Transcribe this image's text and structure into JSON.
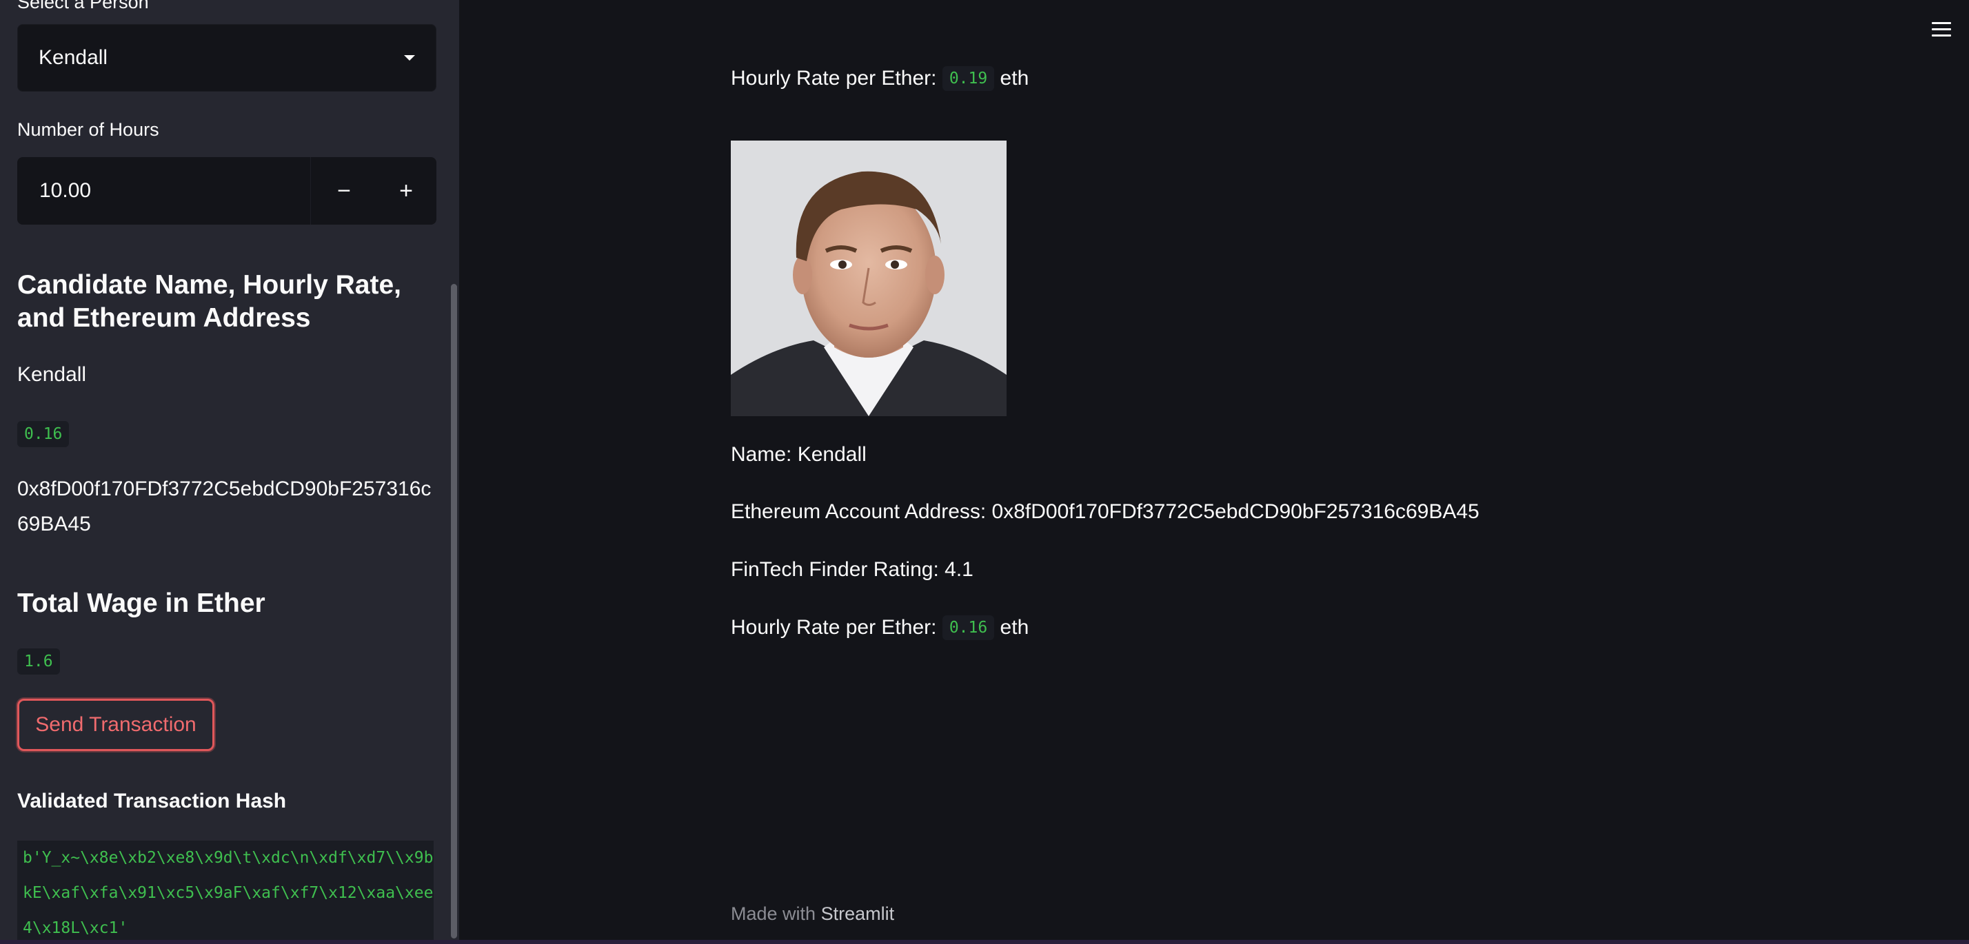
{
  "sidebar": {
    "select_label": "Select a Person",
    "selected_person": "Kendall",
    "hours_label": "Number of Hours",
    "hours_value": "10.00",
    "minus_label": "−",
    "plus_label": "+",
    "candidate_heading": "Candidate Name, Hourly Rate, and Ethereum Address",
    "candidate_name": "Kendall",
    "candidate_rate": "0.16",
    "candidate_address": "0x8fD00f170FDf3772C5ebdCD90bF257316c69BA45",
    "wage_heading": "Total Wage in Ether",
    "wage_value": "1.6",
    "send_button": "Send Transaction",
    "hash_heading": "Validated Transaction Hash",
    "hash_value": "b'Y_x~\\x8e\\xb2\\xe8\\x9d\\t\\xdc\\n\\xdf\\xd7\\\\x9bkE\\xaf\\xfa\\x91\\xc5\\x9aF\\xaf\\xf7\\x12\\xaa\\xee4\\x18L\\xc1'"
  },
  "main": {
    "top_rate_label": "Hourly Rate per Ether:",
    "top_rate_value": "0.19",
    "top_rate_unit": "eth",
    "name_line": "Name: Kendall",
    "address_line": "Ethereum Account Address: 0x8fD00f170FDf3772C5ebdCD90bF257316c69BA45",
    "rating_line": "FinTech Finder Rating: 4.1",
    "rate_label": "Hourly Rate per Ether:",
    "rate_value": "0.16",
    "rate_unit": "eth"
  },
  "footer": {
    "prefix": "Made with",
    "brand": "Streamlit"
  },
  "icons": {
    "menu": "hamburger-menu-icon",
    "dropdown": "chevron-down-icon"
  },
  "colors": {
    "sidebar_bg": "#262730",
    "main_bg": "#131419",
    "code_green": "#3fbf4f",
    "button_red": "#e0575a"
  }
}
